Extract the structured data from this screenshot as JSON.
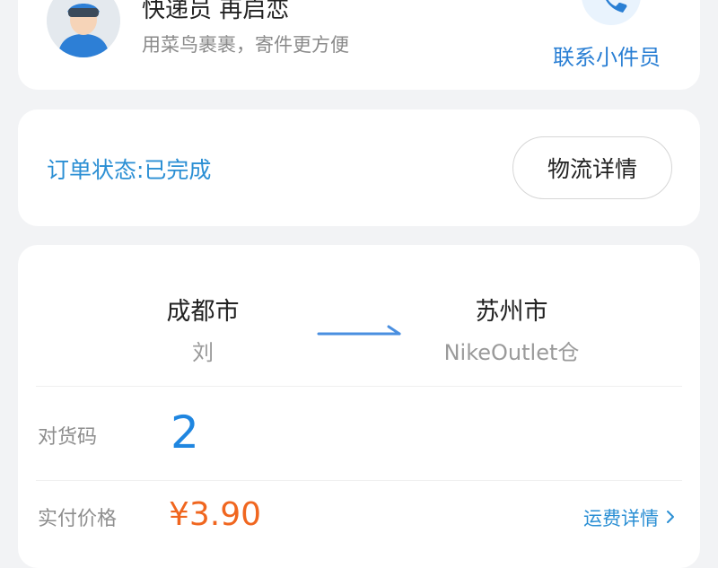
{
  "courier": {
    "title": "快递员 再启恋",
    "subtitle": "用菜鸟裹裹，寄件更方便",
    "contact_label": "联系小件员"
  },
  "order": {
    "status_text": "订单状态:已完成",
    "logistics_button": "物流详情"
  },
  "route": {
    "from_city": "成都市",
    "from_person": "刘",
    "to_city": "苏州市",
    "to_person": "NikeOutlet仓"
  },
  "details": {
    "code_label": "对货码",
    "code_value": "2",
    "price_label": "实付价格",
    "price_value": "¥3.90",
    "fee_link": "运费详情"
  },
  "colors": {
    "accent_blue": "#2b8fd4",
    "code_blue": "#1f86e0",
    "price_orange": "#f0661f",
    "background": "#f2f3f5"
  },
  "icons": {
    "avatar": "courier-avatar",
    "call": "phone-icon",
    "route": "arrow-right-icon",
    "fee_chevron": "chevron-right-icon"
  }
}
